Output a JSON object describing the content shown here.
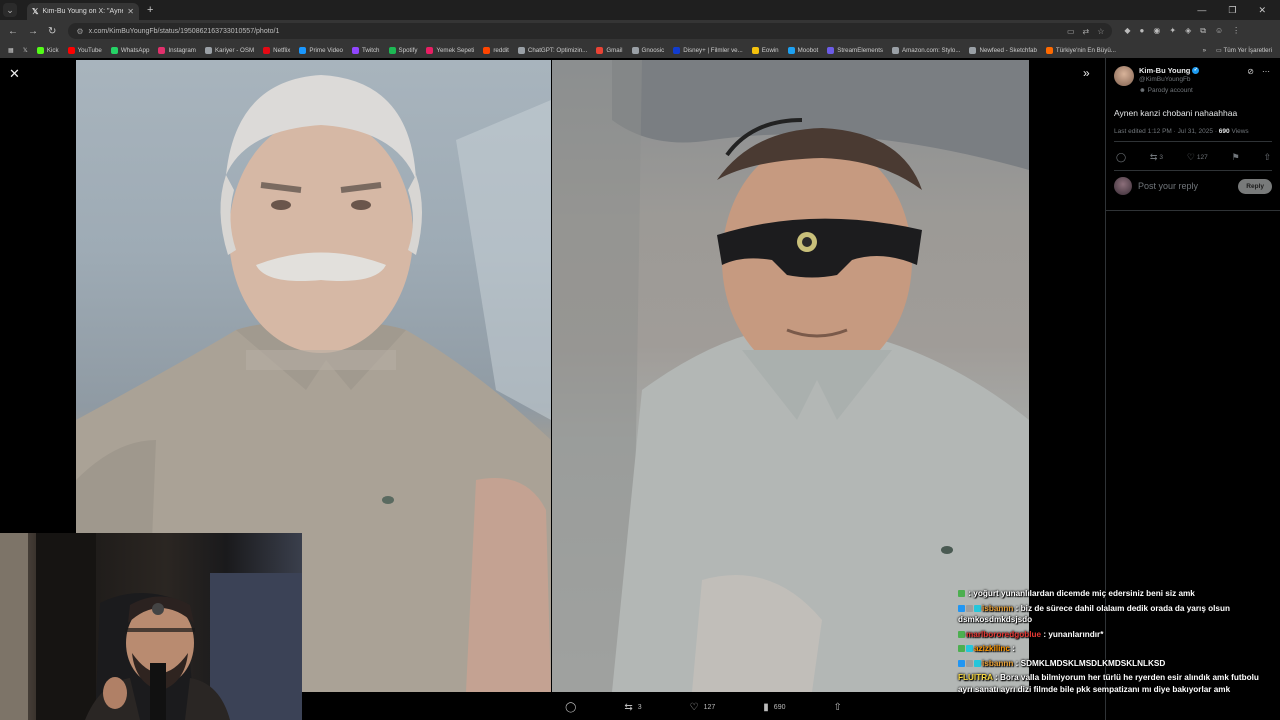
{
  "browser": {
    "tab_title": "Kim-Bu Young on X: \"Aynen ka",
    "url": "x.com/KimBuYoungFb/status/1950862163733010557/photo/1",
    "bookmarks": [
      "Kick",
      "YouTube",
      "WhatsApp",
      "Instagram",
      "Kariyer - OSM",
      "Netflix",
      "Prime Video",
      "Twitch",
      "Spotify",
      "Yemek Sepeti",
      "reddit",
      "ChatGPT: Optimizin...",
      "Gmail",
      "Gnoosic",
      "Disney+ | Filmler ve...",
      "Eowin",
      "Moobot",
      "StreamElements",
      "Amazon.com: Stylo...",
      "Newfeed - Sketchfab",
      "Türkiye'nin En Büyü..."
    ],
    "bookmark_colors": [
      "#53fc18",
      "#ff0000",
      "#25d366",
      "#e1306c",
      "#9aa0a6",
      "#e50914",
      "#1a98ff",
      "#9146ff",
      "#1db954",
      "#e91e63",
      "#ff4500",
      "#9aa0a6",
      "#ea4335",
      "#9aa0a6",
      "#113ccf",
      "#f4c20d",
      "#1da1f2",
      "#6c5ce7",
      "#9aa0a6",
      "#9aa0a6",
      "#ff6a00"
    ],
    "all_bookmarks_label": "Tüm Yer İşaretleri"
  },
  "post": {
    "display_name": "Kim-Bu Young",
    "handle": "@KimBuYoungFb",
    "parody_label": "Parody account",
    "text": "Aynen kanzi chobani nahaahhaa",
    "meta_prefix": "Last edited 1:12 PM · Jul 31, 2025 · ",
    "views_count": "690",
    "views_label": " Views",
    "retweets": "3",
    "likes": "127",
    "reply_placeholder": "Post your reply",
    "reply_button": "Reply"
  },
  "bottom_actions": {
    "retweets": "3",
    "likes": "127",
    "views": "690"
  },
  "chat": [
    {
      "user": "",
      "user_color": "#ff4d4d",
      "text": "yoğurt yunanlılardan dicemde miç edersiniz beni siz amk",
      "badges": [
        "#4caf50"
      ]
    },
    {
      "user": "isbannn",
      "user_color": "#e8a23a",
      "text": "biz de sürece dahil olalaım dedik orada da yarış olsun dsmkosdmkdsjsdo",
      "badges": [
        "#2196f3",
        "#9e9e9e",
        "#26c6da"
      ]
    },
    {
      "user": "marlbororedgoblue",
      "user_color": "#e53935",
      "text": "yunanlarındır*",
      "badges": [
        "#4caf50"
      ]
    },
    {
      "user": "azizkilinc",
      "user_color": "#ff9800",
      "text": "",
      "badges": [
        "#4caf50",
        "#26c6da"
      ]
    },
    {
      "user": "isbannn",
      "user_color": "#e8a23a",
      "text": "SDMKLMDSKLMSDLKMDSKLNLKSD",
      "badges": [
        "#2196f3",
        "#9e9e9e",
        "#26c6da"
      ]
    },
    {
      "user": "FLUITRA",
      "user_color": "#f5d742",
      "text": "Bora valla bilmiyorum her türlü he ryerden esir alındık amk futbolu ayrı sanatı ayrı dizi filmde bile pkk sempatizanı mı diye bakıyorlar amk",
      "badges": []
    }
  ]
}
